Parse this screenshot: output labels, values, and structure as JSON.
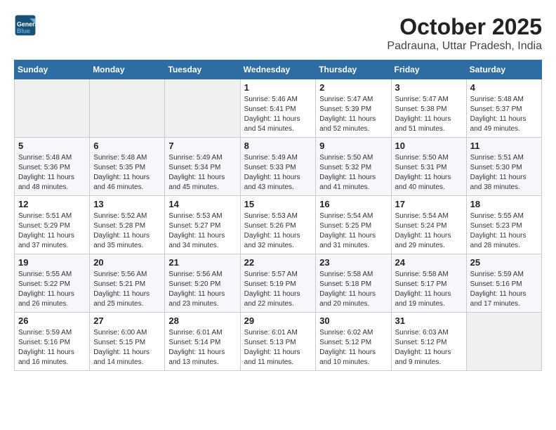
{
  "header": {
    "logo_line1": "General",
    "logo_line2": "Blue",
    "month_title": "October 2025",
    "location": "Padrauna, Uttar Pradesh, India"
  },
  "weekdays": [
    "Sunday",
    "Monday",
    "Tuesday",
    "Wednesday",
    "Thursday",
    "Friday",
    "Saturday"
  ],
  "weeks": [
    [
      {
        "day": "",
        "info": ""
      },
      {
        "day": "",
        "info": ""
      },
      {
        "day": "",
        "info": ""
      },
      {
        "day": "1",
        "info": "Sunrise: 5:46 AM\nSunset: 5:41 PM\nDaylight: 11 hours\nand 54 minutes."
      },
      {
        "day": "2",
        "info": "Sunrise: 5:47 AM\nSunset: 5:39 PM\nDaylight: 11 hours\nand 52 minutes."
      },
      {
        "day": "3",
        "info": "Sunrise: 5:47 AM\nSunset: 5:38 PM\nDaylight: 11 hours\nand 51 minutes."
      },
      {
        "day": "4",
        "info": "Sunrise: 5:48 AM\nSunset: 5:37 PM\nDaylight: 11 hours\nand 49 minutes."
      }
    ],
    [
      {
        "day": "5",
        "info": "Sunrise: 5:48 AM\nSunset: 5:36 PM\nDaylight: 11 hours\nand 48 minutes."
      },
      {
        "day": "6",
        "info": "Sunrise: 5:48 AM\nSunset: 5:35 PM\nDaylight: 11 hours\nand 46 minutes."
      },
      {
        "day": "7",
        "info": "Sunrise: 5:49 AM\nSunset: 5:34 PM\nDaylight: 11 hours\nand 45 minutes."
      },
      {
        "day": "8",
        "info": "Sunrise: 5:49 AM\nSunset: 5:33 PM\nDaylight: 11 hours\nand 43 minutes."
      },
      {
        "day": "9",
        "info": "Sunrise: 5:50 AM\nSunset: 5:32 PM\nDaylight: 11 hours\nand 41 minutes."
      },
      {
        "day": "10",
        "info": "Sunrise: 5:50 AM\nSunset: 5:31 PM\nDaylight: 11 hours\nand 40 minutes."
      },
      {
        "day": "11",
        "info": "Sunrise: 5:51 AM\nSunset: 5:30 PM\nDaylight: 11 hours\nand 38 minutes."
      }
    ],
    [
      {
        "day": "12",
        "info": "Sunrise: 5:51 AM\nSunset: 5:29 PM\nDaylight: 11 hours\nand 37 minutes."
      },
      {
        "day": "13",
        "info": "Sunrise: 5:52 AM\nSunset: 5:28 PM\nDaylight: 11 hours\nand 35 minutes."
      },
      {
        "day": "14",
        "info": "Sunrise: 5:53 AM\nSunset: 5:27 PM\nDaylight: 11 hours\nand 34 minutes."
      },
      {
        "day": "15",
        "info": "Sunrise: 5:53 AM\nSunset: 5:26 PM\nDaylight: 11 hours\nand 32 minutes."
      },
      {
        "day": "16",
        "info": "Sunrise: 5:54 AM\nSunset: 5:25 PM\nDaylight: 11 hours\nand 31 minutes."
      },
      {
        "day": "17",
        "info": "Sunrise: 5:54 AM\nSunset: 5:24 PM\nDaylight: 11 hours\nand 29 minutes."
      },
      {
        "day": "18",
        "info": "Sunrise: 5:55 AM\nSunset: 5:23 PM\nDaylight: 11 hours\nand 28 minutes."
      }
    ],
    [
      {
        "day": "19",
        "info": "Sunrise: 5:55 AM\nSunset: 5:22 PM\nDaylight: 11 hours\nand 26 minutes."
      },
      {
        "day": "20",
        "info": "Sunrise: 5:56 AM\nSunset: 5:21 PM\nDaylight: 11 hours\nand 25 minutes."
      },
      {
        "day": "21",
        "info": "Sunrise: 5:56 AM\nSunset: 5:20 PM\nDaylight: 11 hours\nand 23 minutes."
      },
      {
        "day": "22",
        "info": "Sunrise: 5:57 AM\nSunset: 5:19 PM\nDaylight: 11 hours\nand 22 minutes."
      },
      {
        "day": "23",
        "info": "Sunrise: 5:58 AM\nSunset: 5:18 PM\nDaylight: 11 hours\nand 20 minutes."
      },
      {
        "day": "24",
        "info": "Sunrise: 5:58 AM\nSunset: 5:17 PM\nDaylight: 11 hours\nand 19 minutes."
      },
      {
        "day": "25",
        "info": "Sunrise: 5:59 AM\nSunset: 5:16 PM\nDaylight: 11 hours\nand 17 minutes."
      }
    ],
    [
      {
        "day": "26",
        "info": "Sunrise: 5:59 AM\nSunset: 5:16 PM\nDaylight: 11 hours\nand 16 minutes."
      },
      {
        "day": "27",
        "info": "Sunrise: 6:00 AM\nSunset: 5:15 PM\nDaylight: 11 hours\nand 14 minutes."
      },
      {
        "day": "28",
        "info": "Sunrise: 6:01 AM\nSunset: 5:14 PM\nDaylight: 11 hours\nand 13 minutes."
      },
      {
        "day": "29",
        "info": "Sunrise: 6:01 AM\nSunset: 5:13 PM\nDaylight: 11 hours\nand 11 minutes."
      },
      {
        "day": "30",
        "info": "Sunrise: 6:02 AM\nSunset: 5:12 PM\nDaylight: 11 hours\nand 10 minutes."
      },
      {
        "day": "31",
        "info": "Sunrise: 6:03 AM\nSunset: 5:12 PM\nDaylight: 11 hours\nand 9 minutes."
      },
      {
        "day": "",
        "info": ""
      }
    ]
  ]
}
